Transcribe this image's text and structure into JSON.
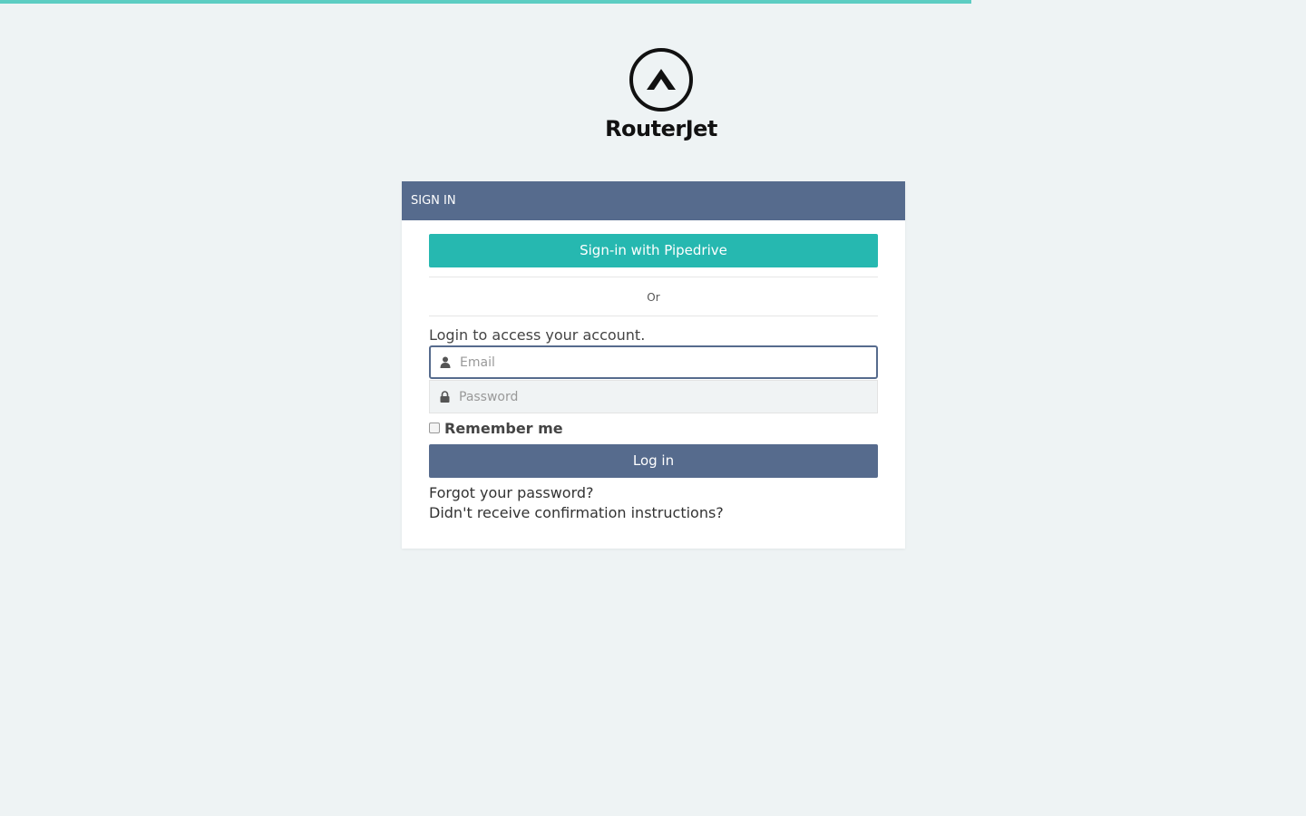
{
  "progress": {
    "value_percent": 74.4,
    "color": "#5ccdc2"
  },
  "brand": {
    "name": "RouterJet",
    "logo_icon": "chevron-up-circle-icon"
  },
  "card": {
    "header_title": "SIGN IN",
    "pipedrive_button_label": "Sign-in with Pipedrive",
    "divider_text": "Or",
    "login_prompt": "Login to access your account.",
    "email": {
      "placeholder": "Email",
      "value": "",
      "icon": "user-icon"
    },
    "password": {
      "placeholder": "Password",
      "value": "",
      "icon": "lock-icon"
    },
    "remember_label": "Remember me",
    "login_button_label": "Log in",
    "forgot_password_link": "Forgot your password?",
    "confirmation_link": "Didn't receive confirmation instructions?"
  },
  "colors": {
    "background": "#eef3f4",
    "header": "#566b8d",
    "pipedrive_button": "#26b8b0",
    "login_button": "#566b8d"
  }
}
